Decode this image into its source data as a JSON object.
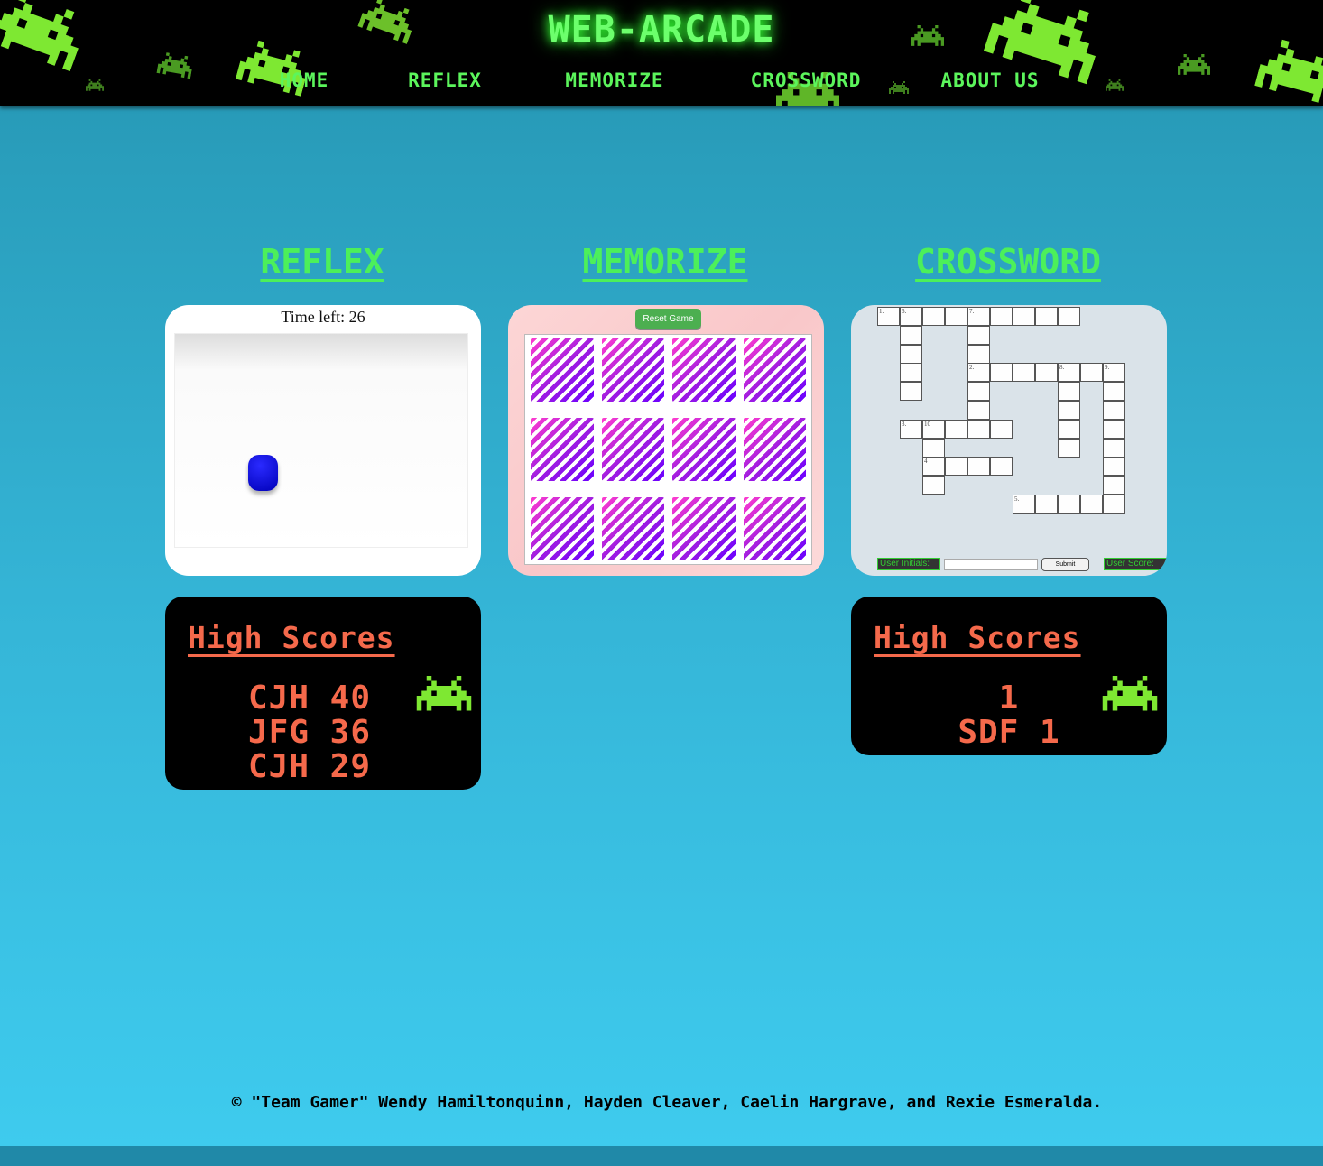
{
  "header": {
    "title": "WEB-ARCADE",
    "nav": [
      "HOME",
      "REFLEX",
      "MEMORIZE",
      "CROSSWORD",
      "ABOUT US"
    ]
  },
  "sections": [
    "REFLEX",
    "MEMORIZE",
    "CROSSWORD"
  ],
  "reflex": {
    "time_left": "Time left: 26"
  },
  "memorize": {
    "reset_label": "Reset Game",
    "tiles": 12
  },
  "crossword": {
    "numbers": [
      "1.",
      "6.",
      "7.",
      "2.",
      "8.",
      "9.",
      "3.",
      "10",
      "4",
      "5."
    ],
    "initials_label": "User Initials:",
    "initials_value": "",
    "submit_label": "Submit",
    "score_label": "User Score:"
  },
  "reflex_scores": {
    "title": "High Scores",
    "rows": [
      "CJH 40",
      "JFG 36",
      "CJH 29"
    ]
  },
  "crossword_scores": {
    "title": "High Scores",
    "rows": [
      "1",
      "SDF 1"
    ]
  },
  "footer": "© \"Team Gamer\" Wendy Hamiltonquinn, Hayden Cleaver, Caelin Hargrave, and Rexie Esmeralda.",
  "colors": {
    "accent": "#4cf05a",
    "score": "#f5694b",
    "header_bg": "#000000",
    "invader": "#7ee832"
  }
}
